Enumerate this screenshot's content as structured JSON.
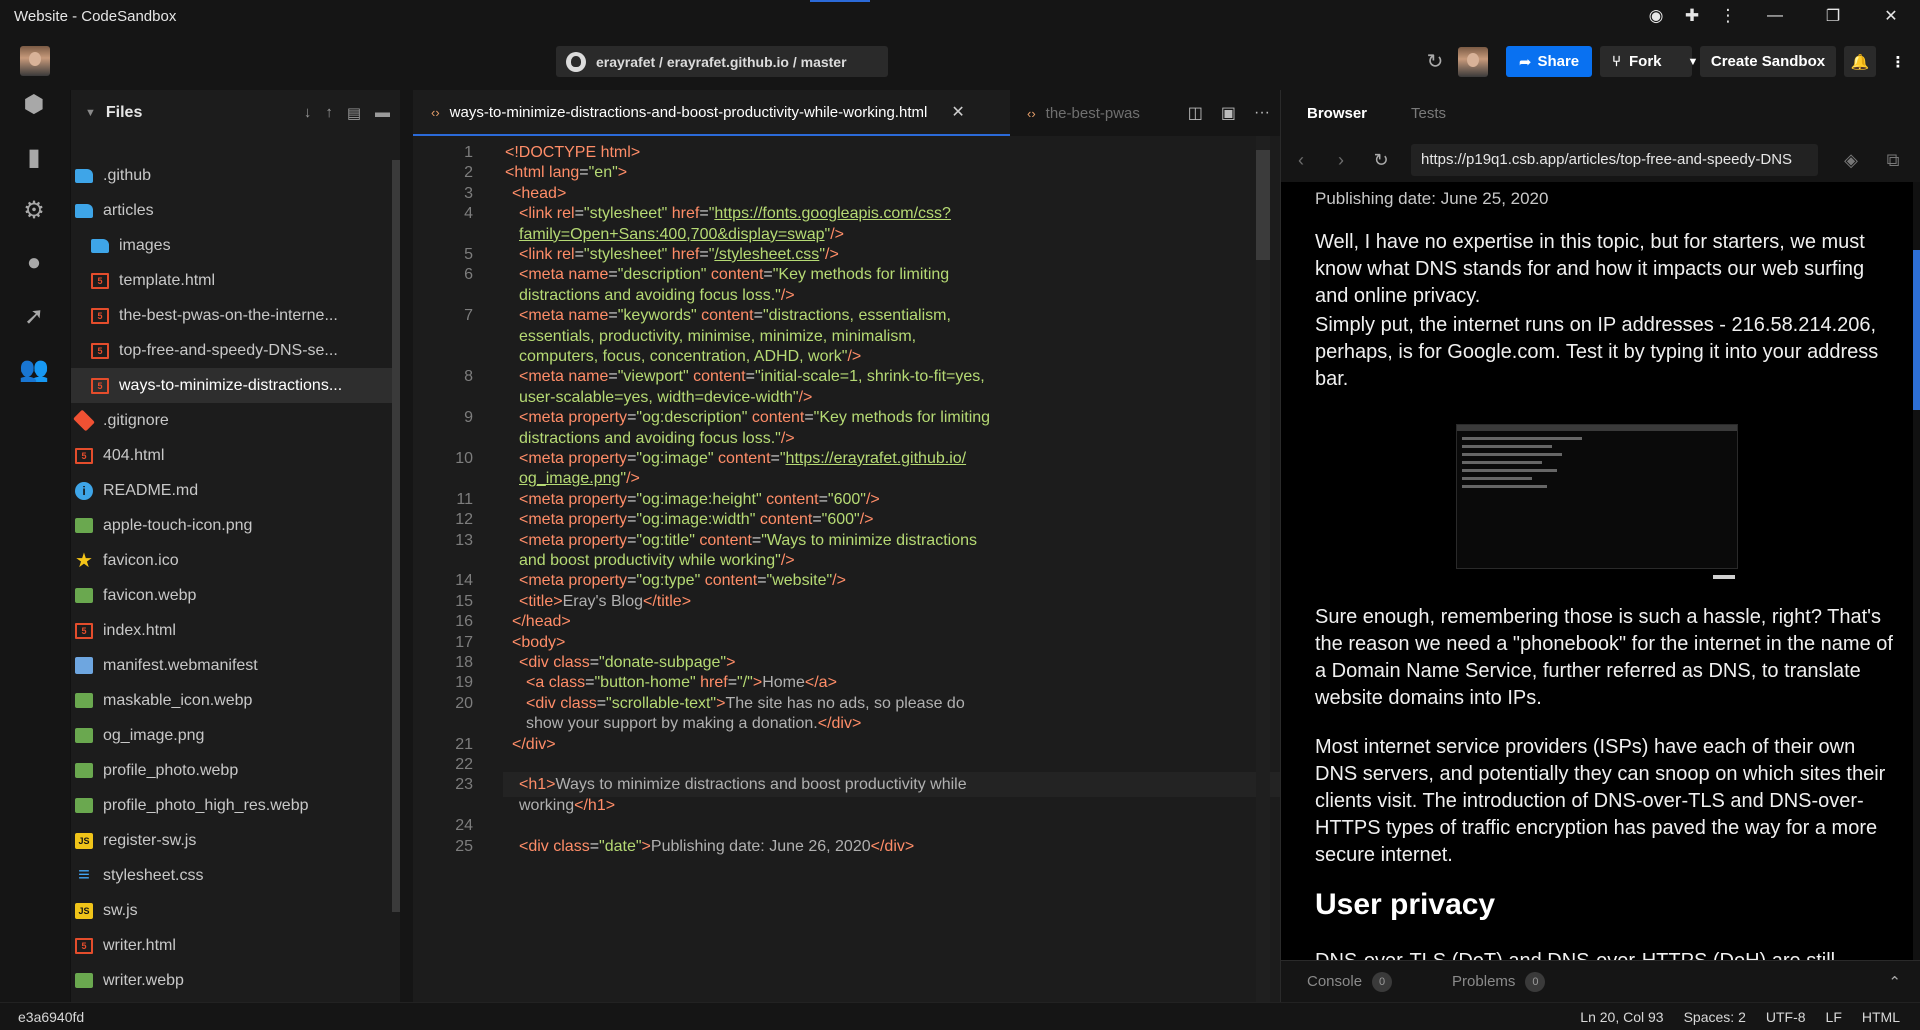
{
  "window": {
    "title": "Website - CodeSandbox"
  },
  "header": {
    "repo": "erayrafet / erayrafet.github.io / master",
    "share_label": "Share",
    "fork_label": "Fork",
    "create_label": "Create Sandbox"
  },
  "explorer": {
    "title": "Files",
    "files": [
      {
        "name": ".github",
        "icon": "folder-icon",
        "indent": 1
      },
      {
        "name": "articles",
        "icon": "folder-open-icon",
        "indent": 1
      },
      {
        "name": "images",
        "icon": "folder-icon",
        "indent": 2
      },
      {
        "name": "template.html",
        "icon": "html-icon",
        "indent": 2
      },
      {
        "name": "the-best-pwas-on-the-interne...",
        "icon": "html-icon",
        "indent": 2
      },
      {
        "name": "top-free-and-speedy-DNS-se...",
        "icon": "html-icon",
        "indent": 2
      },
      {
        "name": "ways-to-minimize-distractions...",
        "icon": "html-icon",
        "indent": 2,
        "active": true
      },
      {
        "name": ".gitignore",
        "icon": "git-icon",
        "indent": 1
      },
      {
        "name": "404.html",
        "icon": "html-icon",
        "indent": 1
      },
      {
        "name": "README.md",
        "icon": "info-icon",
        "indent": 1
      },
      {
        "name": "apple-touch-icon.png",
        "icon": "image-icon",
        "indent": 1
      },
      {
        "name": "favicon.ico",
        "icon": "star-icon",
        "indent": 1
      },
      {
        "name": "favicon.webp",
        "icon": "image-icon",
        "indent": 1
      },
      {
        "name": "index.html",
        "icon": "html-icon",
        "indent": 1
      },
      {
        "name": "manifest.webmanifest",
        "icon": "document-icon",
        "indent": 1
      },
      {
        "name": "maskable_icon.webp",
        "icon": "image-icon",
        "indent": 1
      },
      {
        "name": "og_image.png",
        "icon": "image-icon",
        "indent": 1
      },
      {
        "name": "profile_photo.webp",
        "icon": "image-icon",
        "indent": 1
      },
      {
        "name": "profile_photo_high_res.webp",
        "icon": "image-icon",
        "indent": 1
      },
      {
        "name": "register-sw.js",
        "icon": "js-icon",
        "indent": 1
      },
      {
        "name": "stylesheet.css",
        "icon": "css-icon",
        "indent": 1
      },
      {
        "name": "sw.js",
        "icon": "js-icon",
        "indent": 1
      },
      {
        "name": "writer.html",
        "icon": "html-icon",
        "indent": 1
      },
      {
        "name": "writer.webp",
        "icon": "image-icon",
        "indent": 1
      }
    ]
  },
  "editor": {
    "active_tab": "ways-to-minimize-distractions-and-boost-productivity-while-working.html",
    "inactive_tab": "the-best-pwas",
    "lines": [
      {
        "n": "1",
        "i": 0,
        "t": [
          [
            "tag",
            "<!DOCTYPE html"
          ],
          [
            "tag",
            ">"
          ]
        ]
      },
      {
        "n": "2",
        "i": 0,
        "t": [
          [
            "tag",
            "<html "
          ],
          [
            "attr",
            "lang"
          ],
          [
            "pun",
            "="
          ],
          [
            "str",
            "\"en\""
          ],
          [
            "tag",
            ">"
          ]
        ]
      },
      {
        "n": "3",
        "i": 1,
        "t": [
          [
            "tag",
            "<head>"
          ]
        ]
      },
      {
        "n": "4",
        "i": 2,
        "t": [
          [
            "tag",
            "<link "
          ],
          [
            "attr",
            "rel"
          ],
          [
            "pun",
            "="
          ],
          [
            "str",
            "\"stylesheet\" "
          ],
          [
            "attr",
            "href"
          ],
          [
            "pun",
            "="
          ],
          [
            "str",
            "\""
          ],
          [
            "strl",
            "https://fonts.googleapis.com/css?"
          ]
        ]
      },
      {
        "n": "",
        "i": 2,
        "t": [
          [
            "strl",
            "family=Open+Sans:400,700&display=swap"
          ],
          [
            "str",
            "\""
          ],
          [
            "tag",
            "/>"
          ]
        ]
      },
      {
        "n": "5",
        "i": 2,
        "t": [
          [
            "tag",
            "<link "
          ],
          [
            "attr",
            "rel"
          ],
          [
            "pun",
            "="
          ],
          [
            "str",
            "\"stylesheet\" "
          ],
          [
            "attr",
            "href"
          ],
          [
            "pun",
            "="
          ],
          [
            "str",
            "\""
          ],
          [
            "strl",
            "/stylesheet.css"
          ],
          [
            "str",
            "\""
          ],
          [
            "tag",
            "/>"
          ]
        ]
      },
      {
        "n": "6",
        "i": 2,
        "t": [
          [
            "tag",
            "<meta "
          ],
          [
            "attr",
            "name"
          ],
          [
            "pun",
            "="
          ],
          [
            "str",
            "\"description\" "
          ],
          [
            "attr",
            "content"
          ],
          [
            "pun",
            "="
          ],
          [
            "str",
            "\"Key methods for limiting"
          ]
        ]
      },
      {
        "n": "",
        "i": 2,
        "t": [
          [
            "str",
            "distractions and avoiding focus loss.\""
          ],
          [
            "tag",
            "/>"
          ]
        ]
      },
      {
        "n": "7",
        "i": 2,
        "t": [
          [
            "tag",
            "<meta "
          ],
          [
            "attr",
            "name"
          ],
          [
            "pun",
            "="
          ],
          [
            "str",
            "\"keywords\" "
          ],
          [
            "attr",
            "content"
          ],
          [
            "pun",
            "="
          ],
          [
            "str",
            "\"distractions, essentialism,"
          ]
        ]
      },
      {
        "n": "",
        "i": 2,
        "t": [
          [
            "str",
            "essentials, productivity, minimise, minimize, minimalism,"
          ]
        ]
      },
      {
        "n": "",
        "i": 2,
        "t": [
          [
            "str",
            "computers, focus, concentration, ADHD, work\""
          ],
          [
            "tag",
            "/>"
          ]
        ]
      },
      {
        "n": "8",
        "i": 2,
        "t": [
          [
            "tag",
            "<meta "
          ],
          [
            "attr",
            "name"
          ],
          [
            "pun",
            "="
          ],
          [
            "str",
            "\"viewport\" "
          ],
          [
            "attr",
            "content"
          ],
          [
            "pun",
            "="
          ],
          [
            "str",
            "\"initial-scale=1, shrink-to-fit=yes,"
          ]
        ]
      },
      {
        "n": "",
        "i": 2,
        "t": [
          [
            "str",
            "user-scalable=yes, width=device-width\""
          ],
          [
            "tag",
            "/>"
          ]
        ]
      },
      {
        "n": "9",
        "i": 2,
        "t": [
          [
            "tag",
            "<meta "
          ],
          [
            "attr",
            "property"
          ],
          [
            "pun",
            "="
          ],
          [
            "str",
            "\"og:description\" "
          ],
          [
            "attr",
            "content"
          ],
          [
            "pun",
            "="
          ],
          [
            "str",
            "\"Key methods for limiting"
          ]
        ]
      },
      {
        "n": "",
        "i": 2,
        "t": [
          [
            "str",
            "distractions and avoiding focus loss.\""
          ],
          [
            "tag",
            "/>"
          ]
        ]
      },
      {
        "n": "10",
        "i": 2,
        "t": [
          [
            "tag",
            "<meta "
          ],
          [
            "attr",
            "property"
          ],
          [
            "pun",
            "="
          ],
          [
            "str",
            "\"og:image\" "
          ],
          [
            "attr",
            "content"
          ],
          [
            "pun",
            "="
          ],
          [
            "str",
            "\""
          ],
          [
            "strl",
            "https://erayrafet.github.io/"
          ]
        ]
      },
      {
        "n": "",
        "i": 2,
        "t": [
          [
            "strl",
            "og_image.png"
          ],
          [
            "str",
            "\""
          ],
          [
            "tag",
            "/>"
          ]
        ]
      },
      {
        "n": "11",
        "i": 2,
        "t": [
          [
            "tag",
            "<meta "
          ],
          [
            "attr",
            "property"
          ],
          [
            "pun",
            "="
          ],
          [
            "str",
            "\"og:image:height\" "
          ],
          [
            "attr",
            "content"
          ],
          [
            "pun",
            "="
          ],
          [
            "str",
            "\"600\""
          ],
          [
            "tag",
            "/>"
          ]
        ]
      },
      {
        "n": "12",
        "i": 2,
        "t": [
          [
            "tag",
            "<meta "
          ],
          [
            "attr",
            "property"
          ],
          [
            "pun",
            "="
          ],
          [
            "str",
            "\"og:image:width\" "
          ],
          [
            "attr",
            "content"
          ],
          [
            "pun",
            "="
          ],
          [
            "str",
            "\"600\""
          ],
          [
            "tag",
            "/>"
          ]
        ]
      },
      {
        "n": "13",
        "i": 2,
        "t": [
          [
            "tag",
            "<meta "
          ],
          [
            "attr",
            "property"
          ],
          [
            "pun",
            "="
          ],
          [
            "str",
            "\"og:title\" "
          ],
          [
            "attr",
            "content"
          ],
          [
            "pun",
            "="
          ],
          [
            "str",
            "\"Ways to minimize distractions"
          ]
        ]
      },
      {
        "n": "",
        "i": 2,
        "t": [
          [
            "str",
            "and boost productivity while working\""
          ],
          [
            "tag",
            "/>"
          ]
        ]
      },
      {
        "n": "14",
        "i": 2,
        "t": [
          [
            "tag",
            "<meta "
          ],
          [
            "attr",
            "property"
          ],
          [
            "pun",
            "="
          ],
          [
            "str",
            "\"og:type\" "
          ],
          [
            "attr",
            "content"
          ],
          [
            "pun",
            "="
          ],
          [
            "str",
            "\"website\""
          ],
          [
            "tag",
            "/>"
          ]
        ]
      },
      {
        "n": "15",
        "i": 2,
        "t": [
          [
            "tag",
            "<title>"
          ],
          [
            "txt",
            "Eray's Blog"
          ],
          [
            "tag",
            "</title>"
          ]
        ]
      },
      {
        "n": "16",
        "i": 1,
        "t": [
          [
            "tag",
            "</head>"
          ]
        ]
      },
      {
        "n": "17",
        "i": 1,
        "t": [
          [
            "tag",
            "<body>"
          ]
        ]
      },
      {
        "n": "18",
        "i": 2,
        "t": [
          [
            "tag",
            "<div "
          ],
          [
            "attr",
            "class"
          ],
          [
            "pun",
            "="
          ],
          [
            "str",
            "\"donate-subpage\""
          ],
          [
            "tag",
            ">"
          ]
        ]
      },
      {
        "n": "19",
        "i": 3,
        "t": [
          [
            "tag",
            "<a "
          ],
          [
            "attr",
            "class"
          ],
          [
            "pun",
            "="
          ],
          [
            "str",
            "\"button-home\" "
          ],
          [
            "attr",
            "href"
          ],
          [
            "pun",
            "="
          ],
          [
            "str",
            "\"/\""
          ],
          [
            "tag",
            ">"
          ],
          [
            "txt",
            "Home"
          ],
          [
            "tag",
            "</a>"
          ]
        ]
      },
      {
        "n": "20",
        "i": 3,
        "t": [
          [
            "tag",
            "<div "
          ],
          [
            "attr",
            "class"
          ],
          [
            "pun",
            "="
          ],
          [
            "str",
            "\"scrollable-text\""
          ],
          [
            "tag",
            ">"
          ],
          [
            "txt",
            "The site has no ads, so please do"
          ]
        ]
      },
      {
        "n": "",
        "i": 3,
        "t": [
          [
            "txt",
            "show your support by making a donation."
          ],
          [
            "tag",
            "</div>"
          ]
        ]
      },
      {
        "n": "21",
        "i": 1,
        "t": [
          [
            "tag",
            "</div>"
          ]
        ]
      },
      {
        "n": "22",
        "i": 0,
        "t": []
      },
      {
        "n": "23",
        "i": 2,
        "t": [
          [
            "tag",
            "<h1>"
          ],
          [
            "txt",
            "Ways to minimize distractions and boost productivity while"
          ]
        ]
      },
      {
        "n": "",
        "i": 2,
        "t": [
          [
            "txt",
            "working"
          ],
          [
            "tag",
            "</h1>"
          ]
        ]
      },
      {
        "n": "24",
        "i": 0,
        "t": []
      },
      {
        "n": "25",
        "i": 2,
        "t": [
          [
            "tag",
            "<div "
          ],
          [
            "attr",
            "class"
          ],
          [
            "pun",
            "="
          ],
          [
            "str",
            "\"date\""
          ],
          [
            "tag",
            ">"
          ],
          [
            "txt",
            "Publishing date: June 26, 2020"
          ],
          [
            "tag",
            "</div>"
          ]
        ]
      }
    ]
  },
  "browser": {
    "tab_browser": "Browser",
    "tab_tests": "Tests",
    "url": "https://p19q1.csb.app/articles/top-free-and-speedy-DNS",
    "pubdate": "Publishing date: June 25, 2020",
    "p1": "Well, I have no expertise in this topic, but for starters, we must know what DNS stands for and how it impacts our web surfing and online privacy.",
    "p2": "Simply put, the internet runs on IP addresses - 216.58.214.206, perhaps, is for Google.com. Test it by typing it into your address bar.",
    "p3": "Sure enough, remembering those is such a hassle, right? That's the reason we need a \"phonebook\" for the internet in the name of a Domain Name Service, further referred as DNS, to translate website domains into IPs.",
    "p4": "Most internet service providers (ISPs) have each of their own DNS servers, and potentially they can snoop on which sites their clients visit. The introduction of DNS-over-TLS and DNS-over-HTTPS types of traffic encryption has paved the way for a more secure internet.",
    "h2": "User privacy",
    "p5": "DNS-over-TLS (DoT) and DNS-over-HTTPS (DoH) are still",
    "console_label": "Console",
    "console_count": "0",
    "problems_label": "Problems",
    "problems_count": "0"
  },
  "status": {
    "commit": "e3a6940fd",
    "position": "Ln 20, Col 93",
    "spaces": "Spaces: 2",
    "encoding": "UTF-8",
    "eol": "LF",
    "language": "HTML"
  }
}
